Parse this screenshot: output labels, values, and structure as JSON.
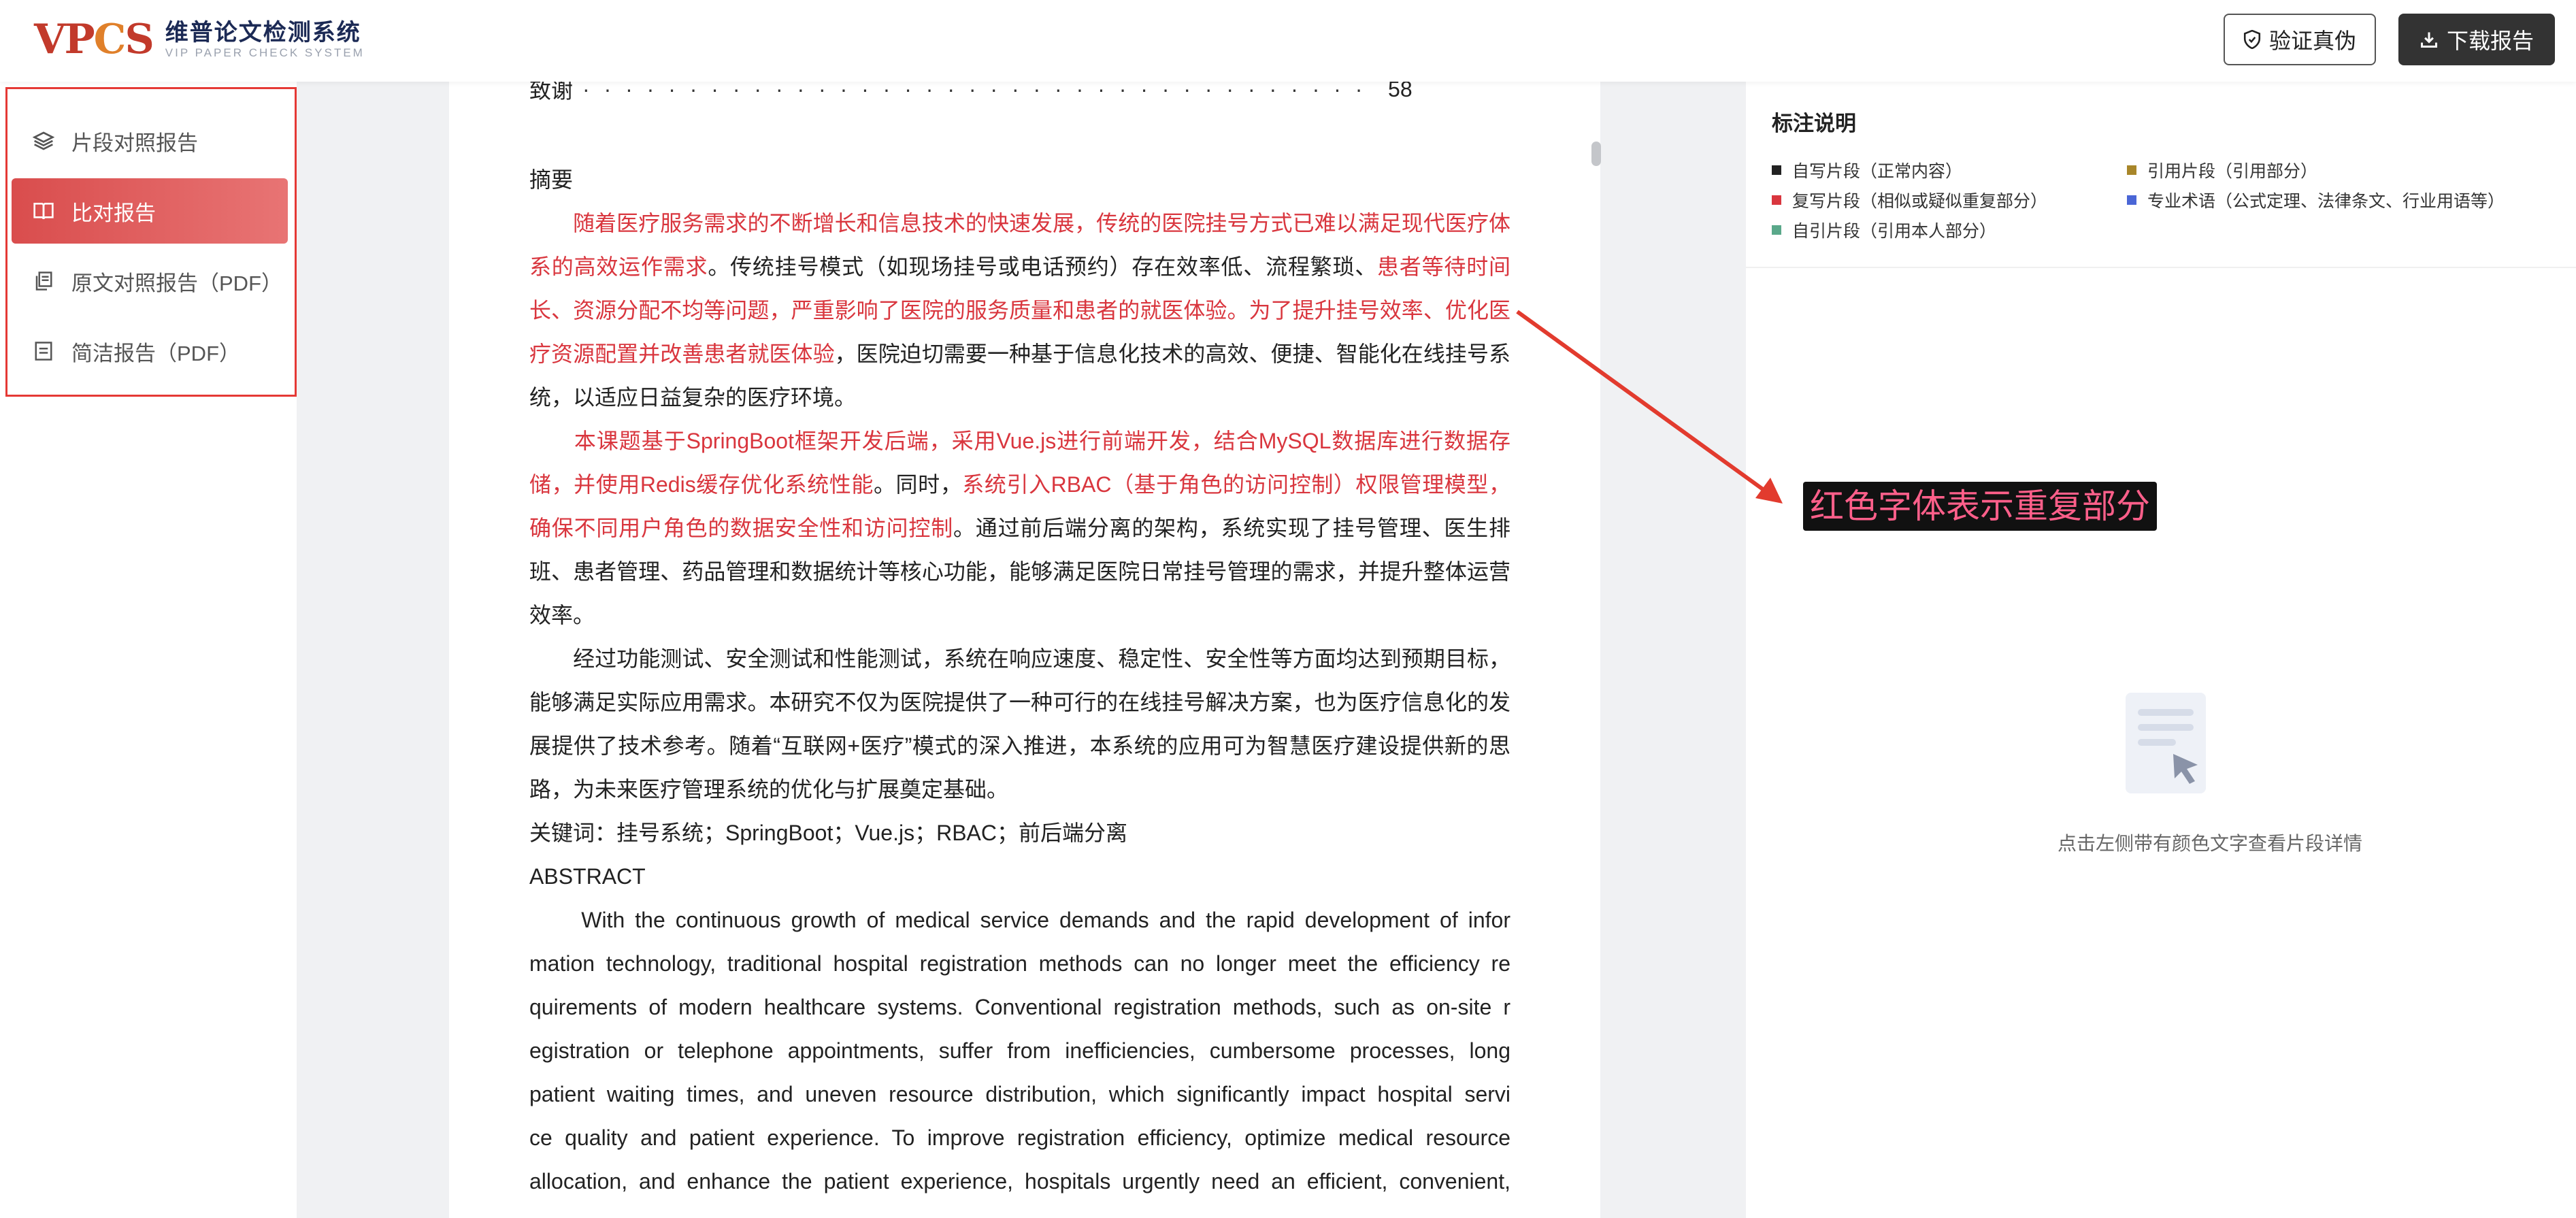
{
  "header": {
    "logo_mark": [
      "VP",
      "C",
      "S"
    ],
    "logo_cn": "维普论文检测系统",
    "logo_en": "VIP PAPER CHECK SYSTEM",
    "verify_label": "验证真伪",
    "download_label": "下载报告"
  },
  "sidebar": {
    "items": [
      {
        "label": "片段对照报告",
        "icon": "layers-icon",
        "active": false
      },
      {
        "label": "比对报告",
        "icon": "book-open-icon",
        "active": true
      },
      {
        "label": "原文对照报告（PDF）",
        "icon": "copy-icon",
        "active": false
      },
      {
        "label": "简洁报告（PDF）",
        "icon": "document-icon",
        "active": false
      }
    ]
  },
  "document": {
    "toc": {
      "label": "致谢",
      "dots": "· · · · · · · · · · · · · · · · · · · · · · · · · · · · · · · · · · · · · · · · · · · · · · · · · · · · · · · ·",
      "page": "58"
    },
    "heading": "摘要",
    "lines": [
      [
        {
          "t": "　　随着医疗服务需求的不断增长和信息技术的快速发展，传统的医院挂号方式已难以满足现代医疗体",
          "red": true
        }
      ],
      [
        {
          "t": "系的高效运作需求",
          "red": true
        },
        {
          "t": "。传统挂号模式（如现场挂号或电话预约）存在效率低、流程繁琐、",
          "red": false
        },
        {
          "t": "患者等待时间",
          "red": true
        }
      ],
      [
        {
          "t": "长、资源分配不均等问题，严重影响了医院的服务质量和患者的就医体验。为了提升挂号效率、优化医",
          "red": true
        }
      ],
      [
        {
          "t": "疗资源配置并改善患者就医体验",
          "red": true
        },
        {
          "t": "，医院迫切需要一种基于信息化技术的高效、便捷、智能化在线挂号系",
          "red": false
        }
      ],
      [
        {
          "t": "统，以适应日益复杂的医疗环境。",
          "red": false
        }
      ],
      [
        {
          "t": "　　本课题基于SpringBoot框架开发后端，采用Vue.js进行前端开发，结合MySQL数据库进行数据存",
          "red": true
        }
      ],
      [
        {
          "t": "储，并使用Redis缓存优化系统性能",
          "red": true
        },
        {
          "t": "。同时，",
          "red": false
        },
        {
          "t": "系统引入RBAC（基于角色的访问控制）权限管理模型，",
          "red": true
        }
      ],
      [
        {
          "t": "确保不同用户角色的数据安全性和访问控制",
          "red": true
        },
        {
          "t": "。通过前后端分离的架构，系统实现了挂号管理、医生排",
          "red": false
        }
      ],
      [
        {
          "t": "班、患者管理、药品管理和数据统计等核心功能，能够满足医院日常挂号管理的需求，并提升整体运营",
          "red": false
        }
      ],
      [
        {
          "t": "效率。",
          "red": false
        }
      ],
      [
        {
          "t": "　　经过功能测试、安全测试和性能测试，系统在响应速度、稳定性、安全性等方面均达到预期目标，",
          "red": false
        }
      ],
      [
        {
          "t": "能够满足实际应用需求。本研究不仅为医院提供了一种可行的在线挂号解决方案，也为医疗信息化的发",
          "red": false
        }
      ],
      [
        {
          "t": "展提供了技术参考。随着“互联网+医疗”模式的深入推进，本系统的应用可为智慧医疗建设提供新的思",
          "red": false
        }
      ],
      [
        {
          "t": "路，为未来医疗管理系统的优化与扩展奠定基础。",
          "red": false
        }
      ],
      [
        {
          "t": "关键词：挂号系统；SpringBoot；Vue.js；RBAC；前后端分离",
          "red": false
        }
      ],
      [
        {
          "t": "ABSTRACT",
          "red": false
        }
      ],
      [
        {
          "t": "　　With the continuous growth of medical service demands and the rapid development of infor",
          "red": false
        }
      ],
      [
        {
          "t": "mation technology, traditional hospital registration methods can no longer meet the efficiency re",
          "red": false
        }
      ],
      [
        {
          "t": "quirements of modern healthcare systems. Conventional registration methods, such as on-site r",
          "red": false
        }
      ],
      [
        {
          "t": "egistration or telephone appointments, suffer from inefficiencies, cumbersome processes, long",
          "red": false
        }
      ],
      [
        {
          "t": "patient waiting times, and uneven resource distribution, which significantly impact hospital servi",
          "red": false
        }
      ],
      [
        {
          "t": "ce quality and patient experience. To improve registration efficiency, optimize medical resource",
          "red": false
        }
      ],
      [
        {
          "t": "allocation, and enhance the patient experience, hospitals urgently need an efficient, convenient,",
          "red": false
        }
      ]
    ]
  },
  "legend": {
    "title": "标注说明",
    "items": [
      {
        "label": "自写片段（正常内容）",
        "color": "#222222"
      },
      {
        "label": "引用片段（引用部分）",
        "color": "#a8862a"
      },
      {
        "label": "复写片段（相似或疑似重复部分）",
        "color": "#d9363e"
      },
      {
        "label": "专业术语（公式定理、法律条文、行业用语等）",
        "color": "#4a66d6"
      },
      {
        "label": "自引片段（引用本人部分）",
        "color": "#5aa88a"
      }
    ]
  },
  "empty_tip": "点击左侧带有颜色文字查看片段详情",
  "annotation": {
    "label": "红色字体表示重复部分",
    "color": "#e23b2e"
  }
}
